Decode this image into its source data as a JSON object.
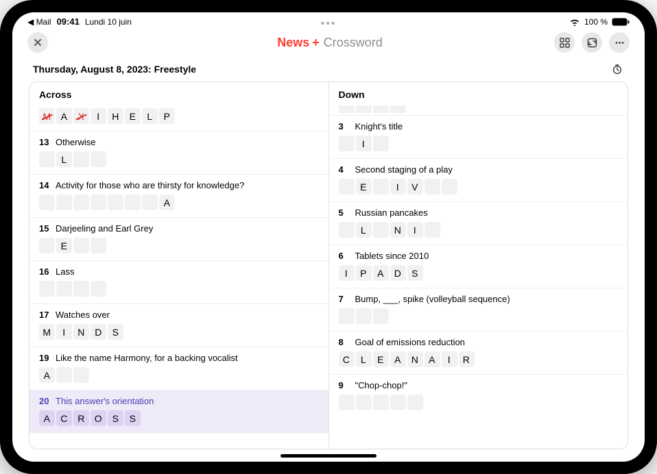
{
  "status": {
    "back_app": "◀ Mail",
    "time": "09:41",
    "date": "Lundi 10 juin",
    "battery": "100 %"
  },
  "nav": {
    "brand_prefix": "",
    "brand_news": "News",
    "brand_plus": "+",
    "brand_crossword": "Crossword"
  },
  "subtitle": "Thursday, August 8, 2023: Freestyle",
  "columns": {
    "across": {
      "header": "Across"
    },
    "down": {
      "header": "Down"
    }
  },
  "clues_across": [
    {
      "num": "",
      "text": "",
      "cells": [
        "M",
        "A",
        "X",
        "I",
        "H",
        "E",
        "L",
        "P"
      ],
      "wrong": [
        0,
        2
      ],
      "nohead": true
    },
    {
      "num": "13",
      "text": "Otherwise",
      "cells": [
        "",
        "L",
        "",
        ""
      ]
    },
    {
      "num": "14",
      "text": "Activity for those who are thirsty for knowledge?",
      "cells": [
        "",
        "",
        "",
        "",
        "",
        "",
        "",
        "A"
      ]
    },
    {
      "num": "15",
      "text": "Darjeeling and Earl Grey",
      "cells": [
        "",
        "E",
        "",
        ""
      ]
    },
    {
      "num": "16",
      "text": "Lass",
      "cells": [
        "",
        "",
        "",
        ""
      ]
    },
    {
      "num": "17",
      "text": "Watches over",
      "cells": [
        "M",
        "I",
        "N",
        "D",
        "S"
      ]
    },
    {
      "num": "19",
      "text": "Like the name Harmony, for a backing vocalist",
      "cells": [
        "A",
        "",
        ""
      ]
    },
    {
      "num": "20",
      "text": "This answer's orientation",
      "cells": [
        "A",
        "C",
        "R",
        "O",
        "S",
        "S"
      ],
      "selected": true
    }
  ],
  "clues_down": [
    {
      "num": "",
      "text": "",
      "cells": [
        "",
        "",
        "",
        ""
      ],
      "peek": true
    },
    {
      "num": "3",
      "text": "Knight's title",
      "cells": [
        "",
        "I",
        ""
      ]
    },
    {
      "num": "4",
      "text": "Second staging of a play",
      "cells": [
        "",
        "E",
        "",
        "I",
        "V",
        "",
        ""
      ]
    },
    {
      "num": "5",
      "text": "Russian pancakes",
      "cells": [
        "",
        "L",
        "",
        "N",
        "I",
        ""
      ]
    },
    {
      "num": "6",
      "text": "Tablets since 2010",
      "cells": [
        "I",
        "P",
        "A",
        "D",
        "S"
      ]
    },
    {
      "num": "7",
      "text": "Bump, ___, spike (volleyball sequence)",
      "cells": [
        "",
        "",
        ""
      ]
    },
    {
      "num": "8",
      "text": "Goal of emissions reduction",
      "cells": [
        "C",
        "L",
        "E",
        "A",
        "N",
        "A",
        "I",
        "R"
      ]
    },
    {
      "num": "9",
      "text": "\"Chop-chop!\"",
      "cells": [
        "",
        "",
        "",
        "",
        ""
      ]
    }
  ]
}
